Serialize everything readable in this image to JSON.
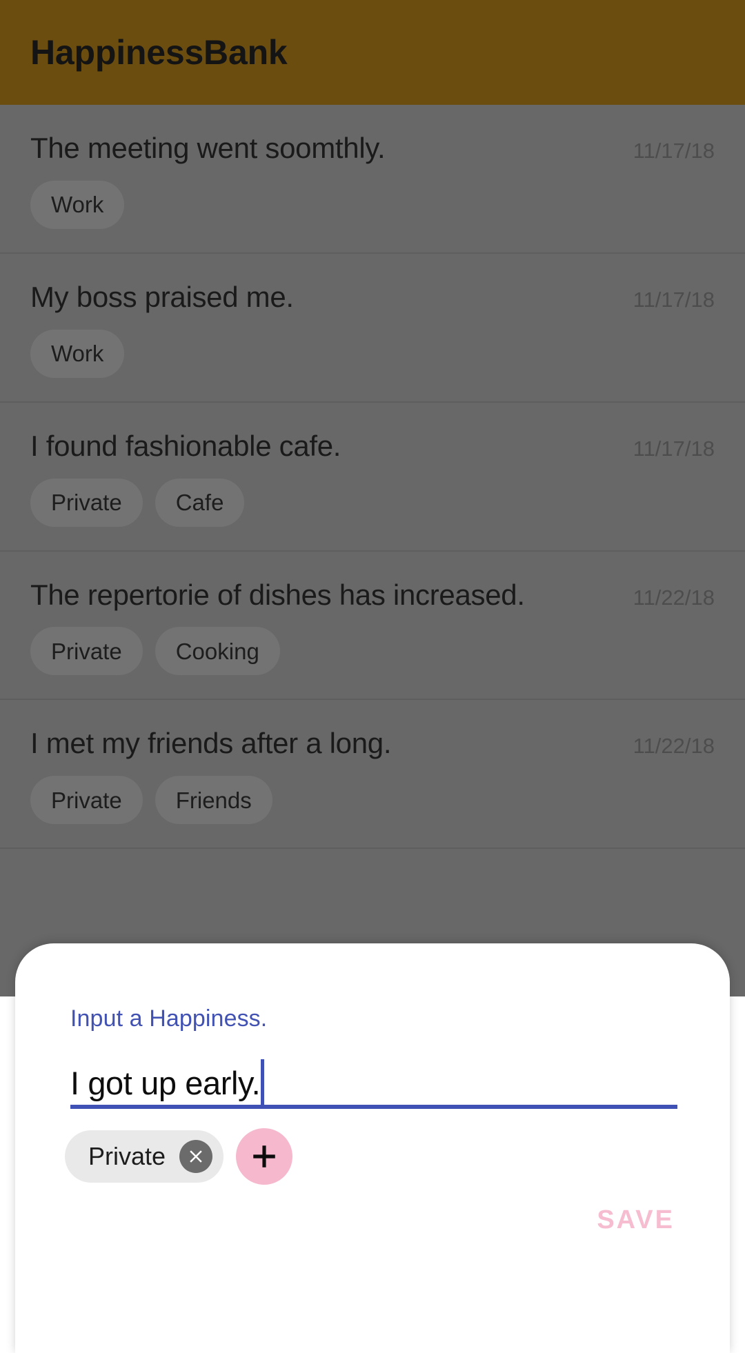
{
  "app": {
    "title": "HappinessBank",
    "appbar_color": "#6b4d10",
    "scrim_color": "#686868"
  },
  "list": {
    "items": [
      {
        "title": "The meeting went soomthly.",
        "date": "11/17/18",
        "tags": [
          "Work"
        ]
      },
      {
        "title": "My boss praised me.",
        "date": "11/17/18",
        "tags": [
          "Work"
        ]
      },
      {
        "title": "I found fashionable cafe.",
        "date": "11/17/18",
        "tags": [
          "Private",
          "Cafe"
        ]
      },
      {
        "title": "The repertorie of dishes has increased.",
        "date": "11/22/18",
        "tags": [
          "Private",
          "Cooking"
        ]
      },
      {
        "title": "I met my friends after a long.",
        "date": "11/22/18",
        "tags": [
          "Private",
          "Friends"
        ]
      }
    ]
  },
  "dialog": {
    "field_label": "Input a Happiness.",
    "field_value": "I got up early.",
    "field_placeholder": "Input a Happiness.",
    "accent_color": "#3f51b5",
    "tags": [
      {
        "label": "Private",
        "delete_icon": "close-circle-icon"
      }
    ],
    "add_tag_icon": "plus-icon",
    "add_tag_color": "#f6b8cd",
    "save_label": "SAVE",
    "save_color": "#f6bdd0"
  }
}
